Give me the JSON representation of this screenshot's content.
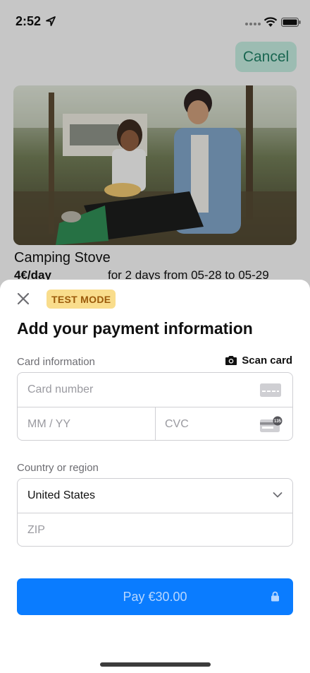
{
  "status_bar": {
    "time": "2:52"
  },
  "header": {
    "cancel_label": "Cancel"
  },
  "item": {
    "title": "Camping Stove",
    "price": "4€/day",
    "dates": "for 2 days from 05-28 to 05-29"
  },
  "payment_sheet": {
    "badge": "TEST MODE",
    "title": "Add your payment information",
    "card_section_label": "Card information",
    "scan_card_label": "Scan card",
    "card_number_placeholder": "Card number",
    "expiry_placeholder": "MM / YY",
    "cvc_placeholder": "CVC",
    "cvc_icon_text": "135",
    "country_section_label": "Country or region",
    "country_value": "United States",
    "zip_placeholder": "ZIP",
    "pay_button_label": "Pay €30.00"
  },
  "colors": {
    "accent": "#0a7cff",
    "cancel_bg": "#bfe6d9",
    "cancel_text": "#1f7d63",
    "badge_bg": "#f9dd8c",
    "badge_text": "#9b5a0a"
  },
  "icons": [
    "location-arrow-icon",
    "signal-icon",
    "wifi-icon",
    "battery-icon",
    "close-icon",
    "camera-icon",
    "credit-card-icon",
    "cvc-card-icon",
    "chevron-down-icon",
    "lock-icon"
  ]
}
